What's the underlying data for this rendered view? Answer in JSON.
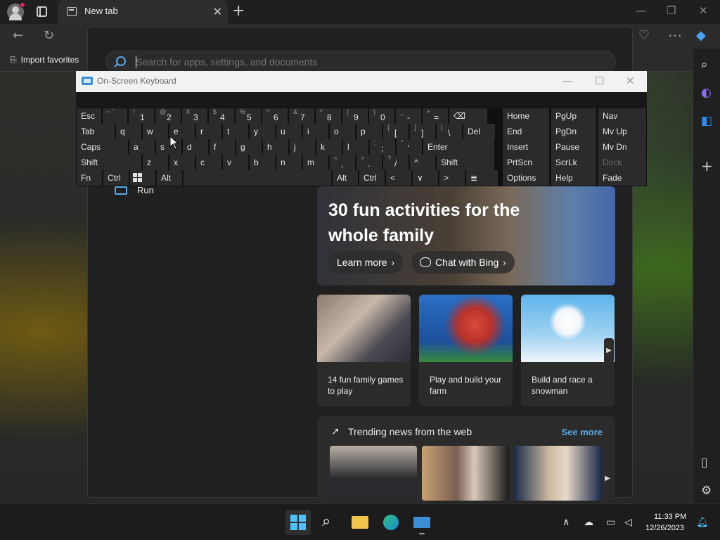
{
  "browser": {
    "tab_title": "New tab",
    "tab_close": "✕",
    "new_tab": "+",
    "favorites_item": "Import favorites"
  },
  "search": {
    "placeholder": "Search for apps, settings, and documents"
  },
  "start": {
    "run_label": "Run",
    "hero": {
      "title": "30 fun activities for the whole family",
      "learn_more": "Learn more",
      "chat_bing": "Chat with Bing"
    },
    "cards": [
      {
        "text": "14 fun family games to play"
      },
      {
        "text": "Play and build your farm"
      },
      {
        "text": "Build and race a snowman"
      }
    ],
    "trending": {
      "heading": "Trending news from the web",
      "see_more": "See more"
    }
  },
  "osk": {
    "title": "On-Screen Keyboard",
    "rows": [
      [
        {
          "label": "Esc"
        },
        {
          "sec": "~",
          "alt": "`"
        },
        {
          "sec": "!",
          "pri": "1"
        },
        {
          "sec": "@",
          "pri": "2"
        },
        {
          "sec": "#",
          "pri": "3"
        },
        {
          "sec": "$",
          "pri": "4"
        },
        {
          "sec": "%",
          "pri": "5"
        },
        {
          "sec": "^",
          "pri": "6"
        },
        {
          "sec": "&",
          "pri": "7"
        },
        {
          "sec": "*",
          "pri": "8"
        },
        {
          "sec": "(",
          "pri": "9"
        },
        {
          "sec": ")",
          "pri": "0"
        },
        {
          "sec": "_",
          "pri": "-"
        },
        {
          "sec": "+",
          "pri": "="
        },
        {
          "icon": "backspace-icon",
          "label": "⌫"
        }
      ],
      [
        {
          "label": "Tab"
        },
        {
          "label": "q"
        },
        {
          "label": "w"
        },
        {
          "label": "e"
        },
        {
          "label": "r"
        },
        {
          "label": "t"
        },
        {
          "label": "y"
        },
        {
          "label": "u"
        },
        {
          "label": "i"
        },
        {
          "label": "o"
        },
        {
          "label": "p"
        },
        {
          "sec": "{",
          "pri": "["
        },
        {
          "sec": "}",
          "pri": "]"
        },
        {
          "sec": "|",
          "pri": "\\"
        },
        {
          "label": "Del"
        }
      ],
      [
        {
          "label": "Caps"
        },
        {
          "label": "a"
        },
        {
          "label": "s"
        },
        {
          "label": "d"
        },
        {
          "label": "f"
        },
        {
          "label": "g"
        },
        {
          "label": "h"
        },
        {
          "label": "j"
        },
        {
          "label": "k"
        },
        {
          "label": "l"
        },
        {
          "sec": ":",
          "pri": ";"
        },
        {
          "sec": "\"",
          "pri": "'"
        },
        {
          "label": "Enter"
        }
      ],
      [
        {
          "label": "Shift"
        },
        {
          "label": "z"
        },
        {
          "label": "x"
        },
        {
          "label": "c"
        },
        {
          "label": "v"
        },
        {
          "label": "b"
        },
        {
          "label": "n"
        },
        {
          "label": "m"
        },
        {
          "sec": "<",
          "pri": ","
        },
        {
          "sec": ">",
          "pri": "."
        },
        {
          "sec": "?",
          "pri": "/"
        },
        {
          "label": "^"
        },
        {
          "label": "Shift"
        }
      ],
      [
        {
          "label": "Fn"
        },
        {
          "label": "Ctrl"
        },
        {
          "icon": "windows-icon",
          "label": ""
        },
        {
          "label": "Alt"
        },
        {
          "label": ""
        },
        {
          "label": "Alt"
        },
        {
          "label": "Ctrl"
        },
        {
          "label": "<"
        },
        {
          "label": "∨"
        },
        {
          "label": ">"
        },
        {
          "icon": "menu-icon",
          "label": "≣"
        }
      ]
    ],
    "nav_keys": [
      [
        "Home",
        "PgUp",
        "Nav"
      ],
      [
        "End",
        "PgDn",
        "Mv Up"
      ],
      [
        "Insert",
        "Pause",
        "Mv Dn"
      ],
      [
        "PrtScn",
        "ScrLk",
        "Dock"
      ],
      [
        "Options",
        "Help",
        "Fade"
      ]
    ]
  },
  "taskbar": {
    "time": "11:33 PM",
    "date": "12/26/2023"
  }
}
